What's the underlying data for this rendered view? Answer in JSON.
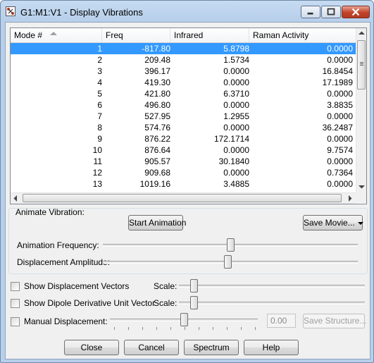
{
  "window": {
    "title": "G1:M1:V1 - Display Vibrations",
    "icon": "gaussview-app-icon",
    "controls": [
      "minimize-icon",
      "maximize-icon",
      "close-icon"
    ]
  },
  "table": {
    "columns": [
      "Mode #",
      "Freq",
      "Infrared",
      "Raman Activity"
    ],
    "sorted_column": "Mode #",
    "selected_row_index": 0,
    "rows": [
      {
        "mode": "1",
        "freq": "-817.80",
        "ir": "5.8798",
        "raman": "0.0000"
      },
      {
        "mode": "2",
        "freq": "209.48",
        "ir": "1.5734",
        "raman": "0.0000"
      },
      {
        "mode": "3",
        "freq": "396.17",
        "ir": "0.0000",
        "raman": "16.8454"
      },
      {
        "mode": "4",
        "freq": "419.30",
        "ir": "0.0000",
        "raman": "17.1989"
      },
      {
        "mode": "5",
        "freq": "421.80",
        "ir": "6.3710",
        "raman": "0.0000"
      },
      {
        "mode": "6",
        "freq": "496.80",
        "ir": "0.0000",
        "raman": "3.8835"
      },
      {
        "mode": "7",
        "freq": "527.95",
        "ir": "1.2955",
        "raman": "0.0000"
      },
      {
        "mode": "8",
        "freq": "574.76",
        "ir": "0.0000",
        "raman": "36.2487"
      },
      {
        "mode": "9",
        "freq": "876.22",
        "ir": "172.1714",
        "raman": "0.0000"
      },
      {
        "mode": "10",
        "freq": "876.64",
        "ir": "0.0000",
        "raman": "9.7574"
      },
      {
        "mode": "11",
        "freq": "905.57",
        "ir": "30.1840",
        "raman": "0.0000"
      },
      {
        "mode": "12",
        "freq": "909.68",
        "ir": "0.0000",
        "raman": "0.7364"
      },
      {
        "mode": "13",
        "freq": "1019.16",
        "ir": "3.4885",
        "raman": "0.0000"
      }
    ]
  },
  "animate": {
    "group_label": "Animate Vibration:",
    "start_button": "Start Animation",
    "save_movie_button": "Save Movie...",
    "frequency_label": "Animation Frequency:",
    "frequency_level": 0.5,
    "amplitude_label": "Displacement Amplitude:",
    "amplitude_level": 0.49
  },
  "options": {
    "show_vectors_label": "Show Displacement Vectors",
    "show_vectors_checked": false,
    "vectors_scale_label": "Scale:",
    "vectors_scale_level": 0.08,
    "show_dipole_label": "Show Dipole Derivative Unit Vector",
    "show_dipole_checked": false,
    "dipole_scale_label": "Scale:",
    "dipole_scale_level": 0.08,
    "manual_label": "Manual Displacement:",
    "manual_checked": false,
    "manual_level": 0.5,
    "manual_value": "0.00",
    "save_structure_button": "Save Structure..."
  },
  "footer": {
    "close": "Close",
    "cancel": "Cancel",
    "spectrum": "Spectrum",
    "help": "Help"
  }
}
